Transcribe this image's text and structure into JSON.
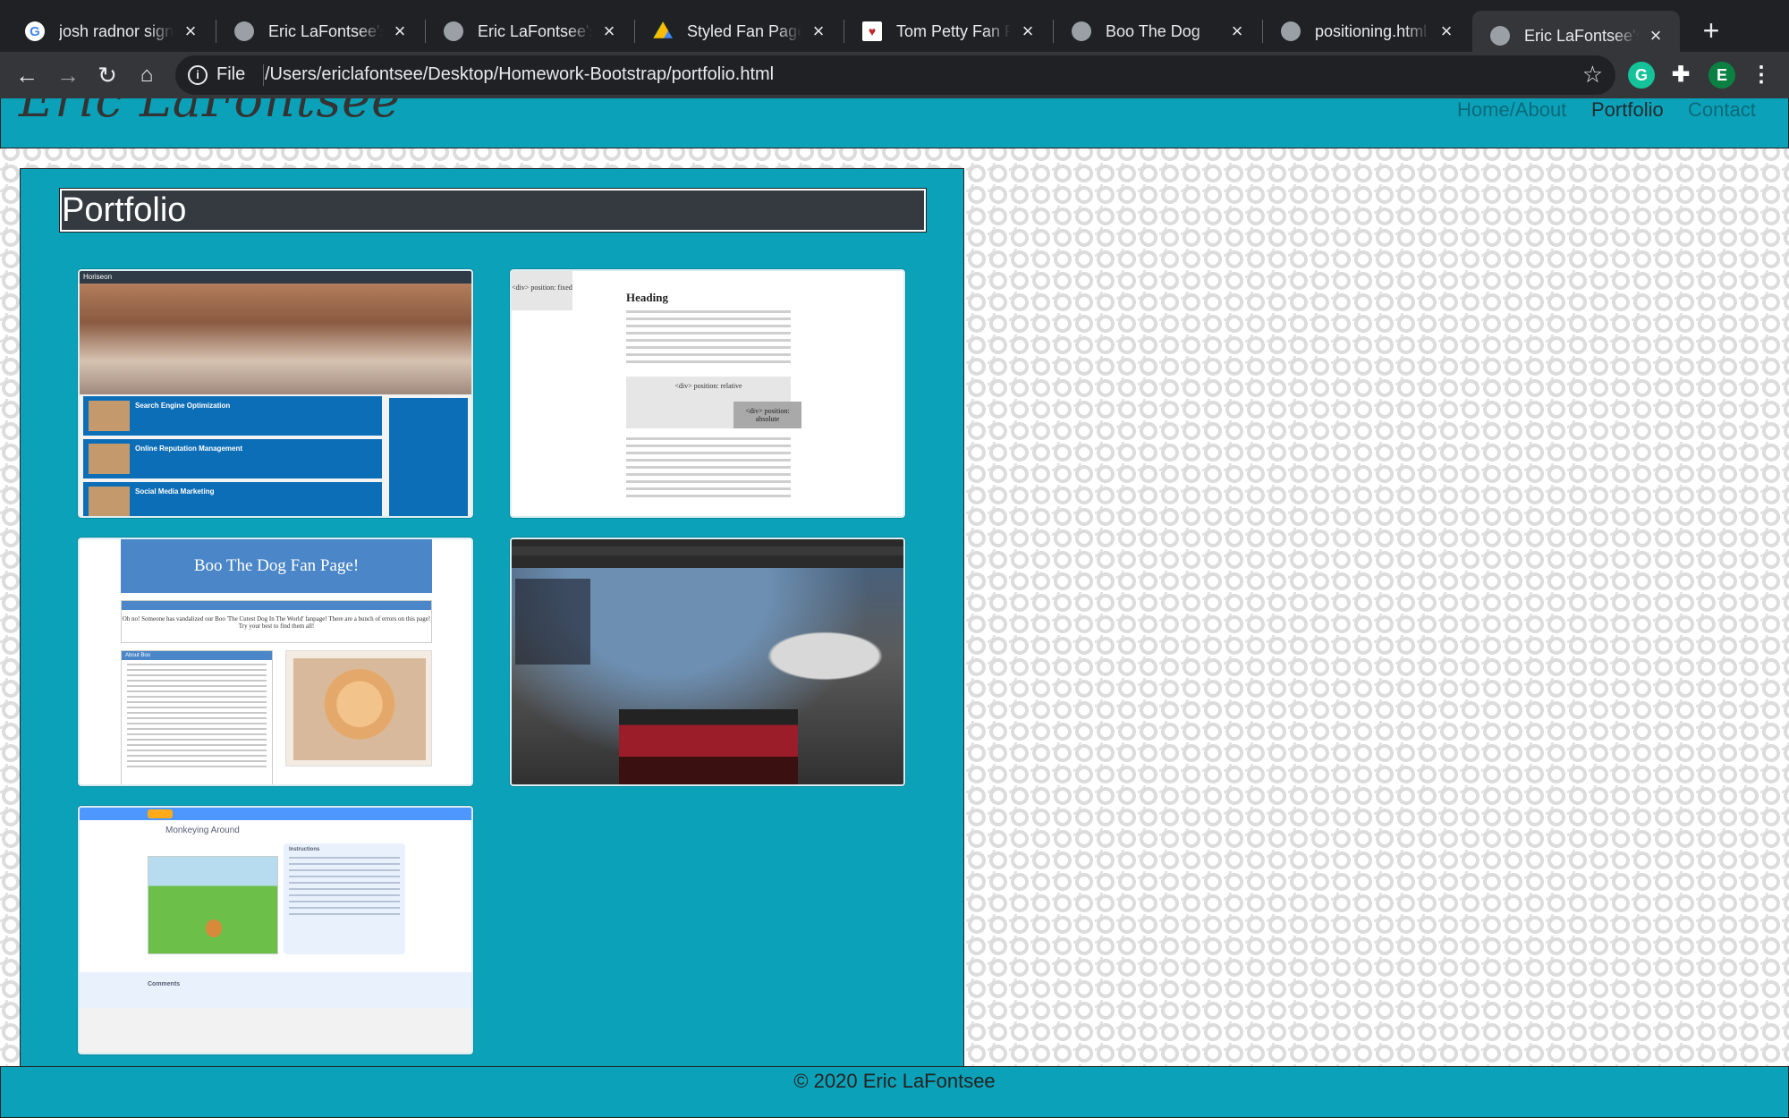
{
  "browser": {
    "tabs": [
      {
        "title": "josh radnor sign la",
        "favicon": "google-icon"
      },
      {
        "title": "Eric LaFontsee's P",
        "favicon": "globe-icon"
      },
      {
        "title": "Eric LaFontsee's P",
        "favicon": "globe-icon"
      },
      {
        "title": "Styled Fan Page -",
        "favicon": "google-drive-icon"
      },
      {
        "title": "Tom Petty Fan Pag",
        "favicon": "tom-petty-icon"
      },
      {
        "title": "Boo The Dog",
        "favicon": "globe-icon"
      },
      {
        "title": "positioning.html",
        "favicon": "globe-icon"
      },
      {
        "title": "Eric LaFontsee's P",
        "favicon": "globe-icon",
        "active": true
      }
    ],
    "address": {
      "scheme": "File",
      "url": "/Users/ericlafontsee/Desktop/Homework-Bootstrap/portfolio.html"
    },
    "extensions": {
      "grammarly": "G",
      "profile": "E"
    },
    "colors": {
      "accent_green": "#15c39a",
      "profile_green": "#0b8043"
    }
  },
  "site": {
    "brand": "Eric LaFontsee",
    "nav": [
      {
        "label": "Home/About",
        "current": false
      },
      {
        "label": "Portfolio",
        "current": true
      },
      {
        "label": "Contact",
        "current": false
      }
    ],
    "page_title": "Portfolio",
    "colors": {
      "teal": "#0ba2b9",
      "title_bg": "#343a40"
    },
    "thumbnails": {
      "t1": {
        "brand": "Horiseon",
        "cards": [
          "Search Engine Optimization",
          "Online Reputation Management",
          "Social Media Marketing"
        ]
      },
      "t2": {
        "fixed_box": "<div> position: fixed",
        "heading": "Heading",
        "relative_box": "<div> position: relative",
        "absolute_box": "<div> position: absolute"
      },
      "t3": {
        "banner": "Boo The Dog Fan Page!",
        "instructions": "Oh no! Someone has vandalized our Boo 'The Cutest Dog In The World' fanpage! There are a bunch of errors on this page! Try your best to find them all!",
        "about_heading": "About Boo"
      },
      "t5": {
        "project_title": "Monkeying Around",
        "instructions_heading": "Instructions",
        "comments": "Comments"
      }
    },
    "footer": "© 2020 Eric LaFontsee"
  }
}
